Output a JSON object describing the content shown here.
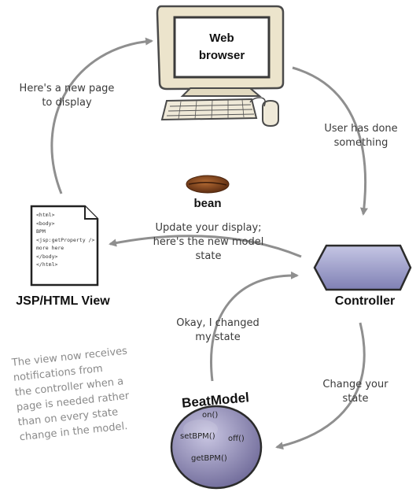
{
  "browser": {
    "label_line1": "Web",
    "label_line2": "browser"
  },
  "edges": {
    "new_page": [
      "Here's a new page",
      "to display"
    ],
    "user_done": [
      "User has done",
      "something"
    ],
    "update_display": [
      "Update your display;",
      "here's the new model",
      "state"
    ],
    "changed_state": [
      "Okay, I changed",
      "my state"
    ],
    "change_state": [
      "Change your",
      "state"
    ]
  },
  "bean": {
    "label": "bean"
  },
  "view": {
    "title": "JSP/HTML View",
    "code_lines": [
      "<html>",
      "<body>",
      "BPM",
      "<jsp:getProperty />",
      "more here",
      "</body>",
      "</html>"
    ]
  },
  "controller": {
    "title": "Controller"
  },
  "model": {
    "title": "BeatModel",
    "methods": {
      "on": "on()",
      "setbpm": "setBPM()",
      "off": "off()",
      "getbpm": "getBPM()"
    }
  },
  "note": {
    "lines": [
      "The view now receives",
      "notifications from",
      "the controller when a",
      "page is needed rather",
      "than on every state",
      "change in the model."
    ]
  },
  "colors": {
    "arrow": "#8f8f8f",
    "monitor_frame": "#eae2c8",
    "controller_fill": "#9b9bc8",
    "model_fill": "#8c88b4",
    "bean_fill": "#8a4a22"
  }
}
